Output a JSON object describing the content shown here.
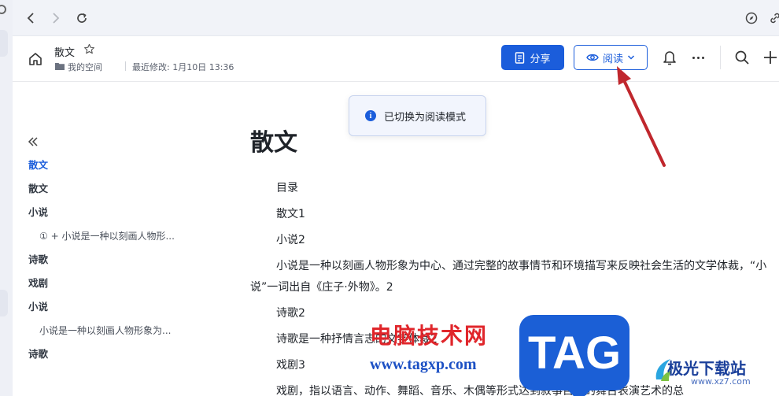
{
  "header": {
    "doc_title": "散文",
    "space_name": "我的空间",
    "last_modified": "最近修改: 1月10日 13:36",
    "share_label": "分享",
    "read_label": "阅读"
  },
  "toast": {
    "message": "已切换为阅读模式"
  },
  "outline": {
    "items": [
      {
        "label": "散文"
      },
      {
        "label": "散文"
      },
      {
        "label": "小说"
      },
      {
        "label": "① + 小说是一种以刻画人物形..."
      },
      {
        "label": "诗歌"
      },
      {
        "label": "戏剧"
      },
      {
        "label": "小说"
      },
      {
        "label": "小说是一种以刻画人物形象为..."
      },
      {
        "label": "诗歌"
      }
    ]
  },
  "content": {
    "title": "散文",
    "paragraphs": [
      "目录",
      "散文1",
      "小说2",
      "小说是一种以刻画人物形象为中心、通过完整的故事情节和环境描写来反映社会生活的文学体裁，“小说”一词出自《庄子·外物》。2",
      "诗歌2",
      "诗歌是一种抒情言志的文学体裁2",
      "戏剧3",
      "戏剧，指以语言、动作、舞蹈、音乐、木偶等形式达到叙事目的的舞台表演艺术的总"
    ]
  },
  "watermark": {
    "cn_text": "电脑技术网",
    "url": "www.tagxp.com",
    "tag": "TAG",
    "site_name": "极光下载站",
    "site_url": "www.xz7.com"
  },
  "colors": {
    "accent": "#1b5ddb",
    "arrow": "#c0272d"
  }
}
